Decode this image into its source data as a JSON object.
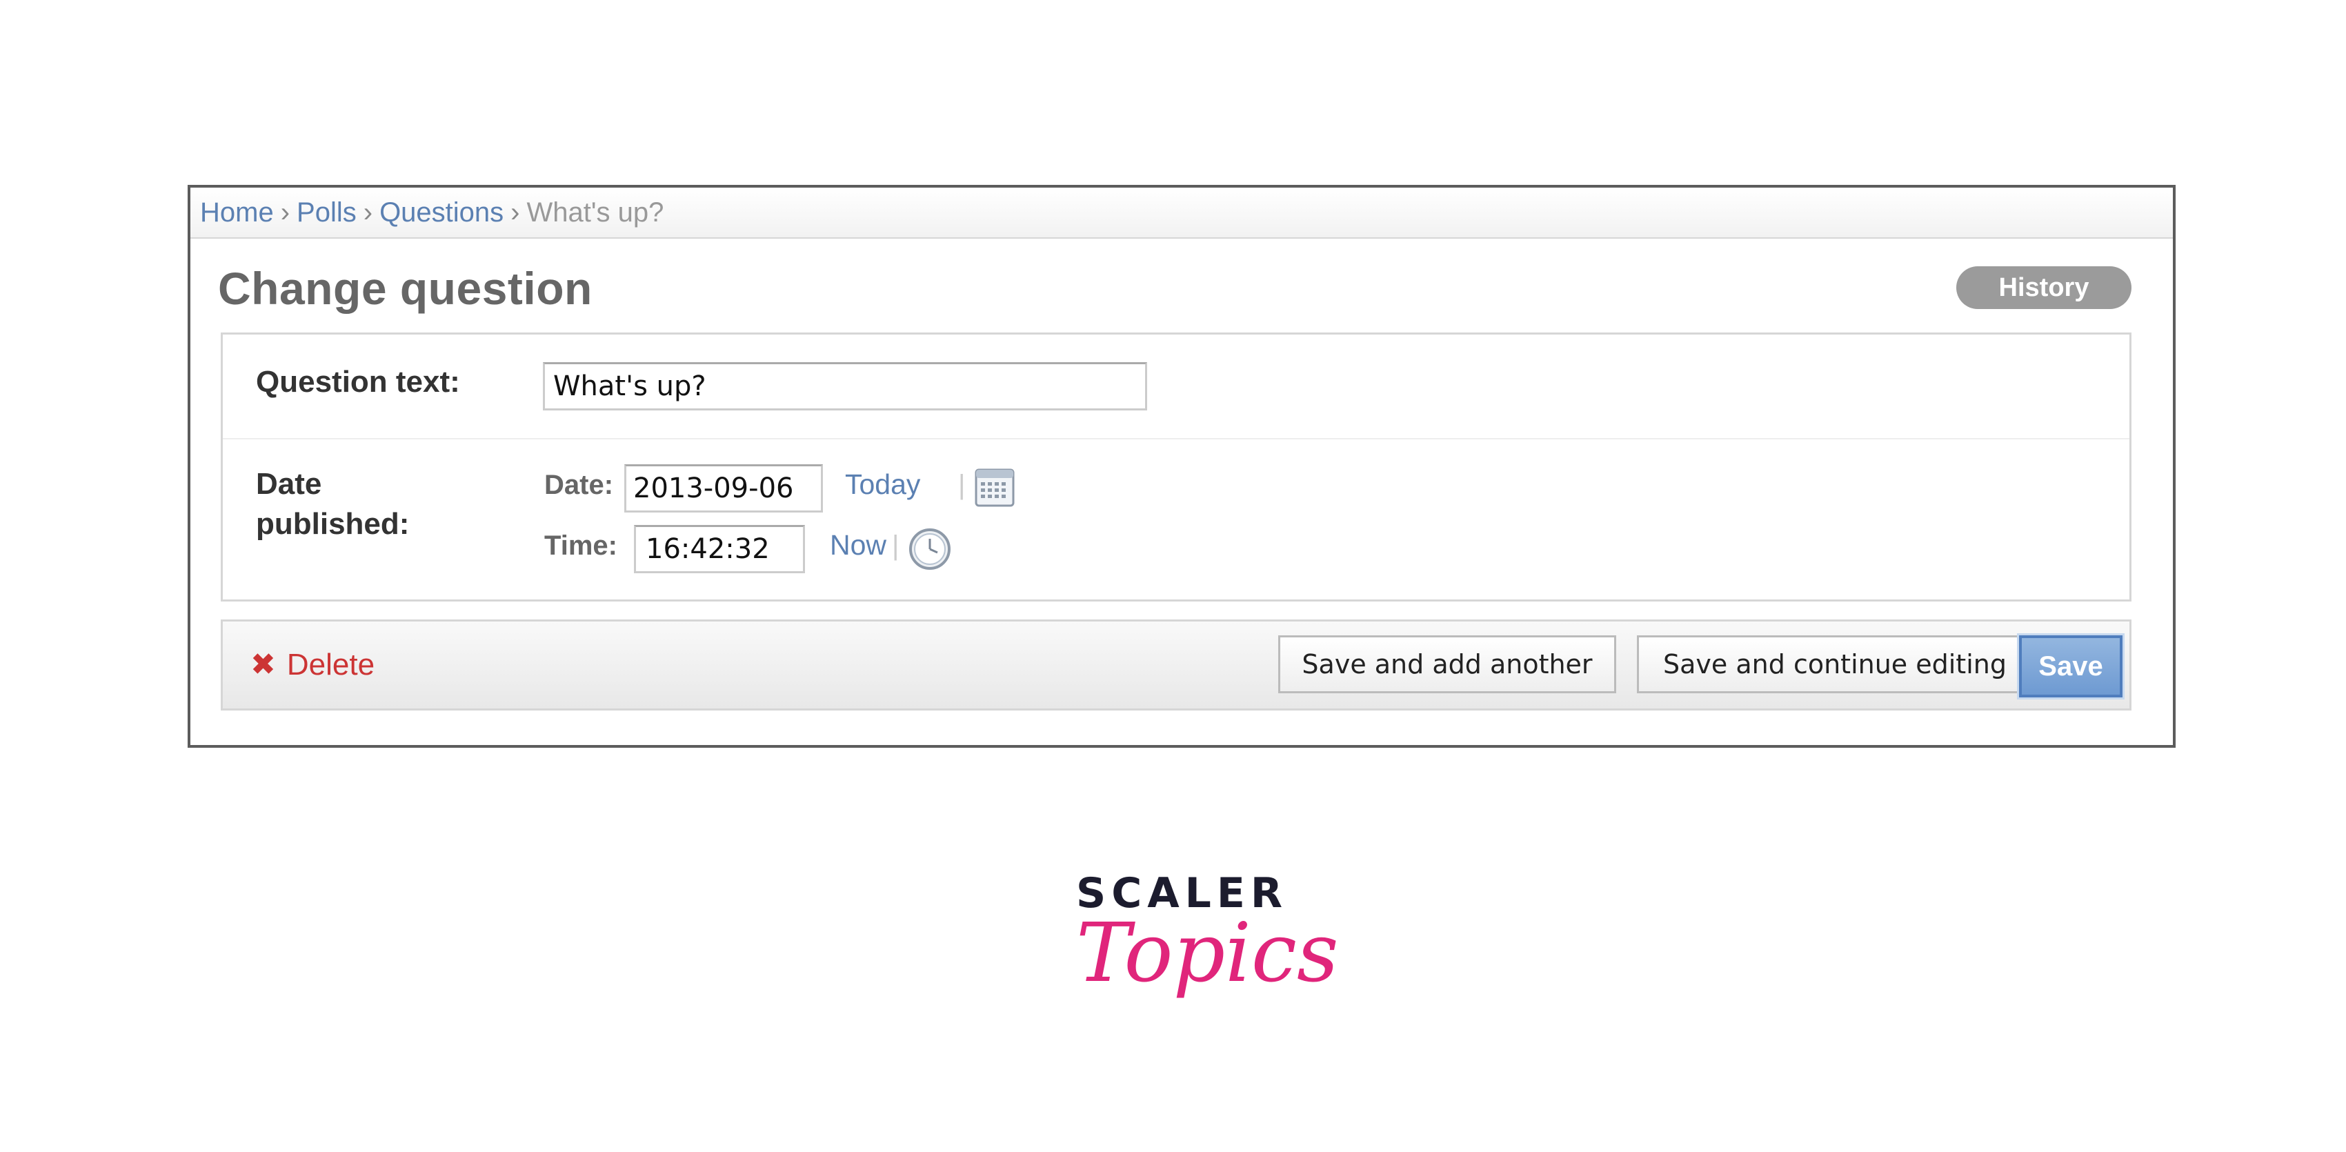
{
  "breadcrumbs": {
    "items": [
      "Home",
      "Polls",
      "Questions"
    ],
    "separator": "›",
    "current": "What's up?"
  },
  "page": {
    "title": "Change question",
    "history_label": "History"
  },
  "form": {
    "question_text": {
      "label": "Question text:",
      "value": "What's up?"
    },
    "date_published": {
      "label_line1": "Date",
      "label_line2": "published:",
      "date_label": "Date:",
      "date_value": "2013-09-06",
      "today_link": "Today",
      "time_label": "Time:",
      "time_value": "16:42:32",
      "now_link": "Now",
      "shortcut_separator": "|"
    }
  },
  "submit_row": {
    "delete_label": "Delete",
    "delete_icon": "✖",
    "save_add_another": "Save and add another",
    "save_continue": "Save and continue editing",
    "save": "Save"
  },
  "brand": {
    "line1": "SCALER",
    "line2": "Topics"
  },
  "colors": {
    "link": "#5b80b2",
    "delete": "#cc3434",
    "save_button": "#6e9ad2",
    "brand_pink": "#e0257b"
  }
}
